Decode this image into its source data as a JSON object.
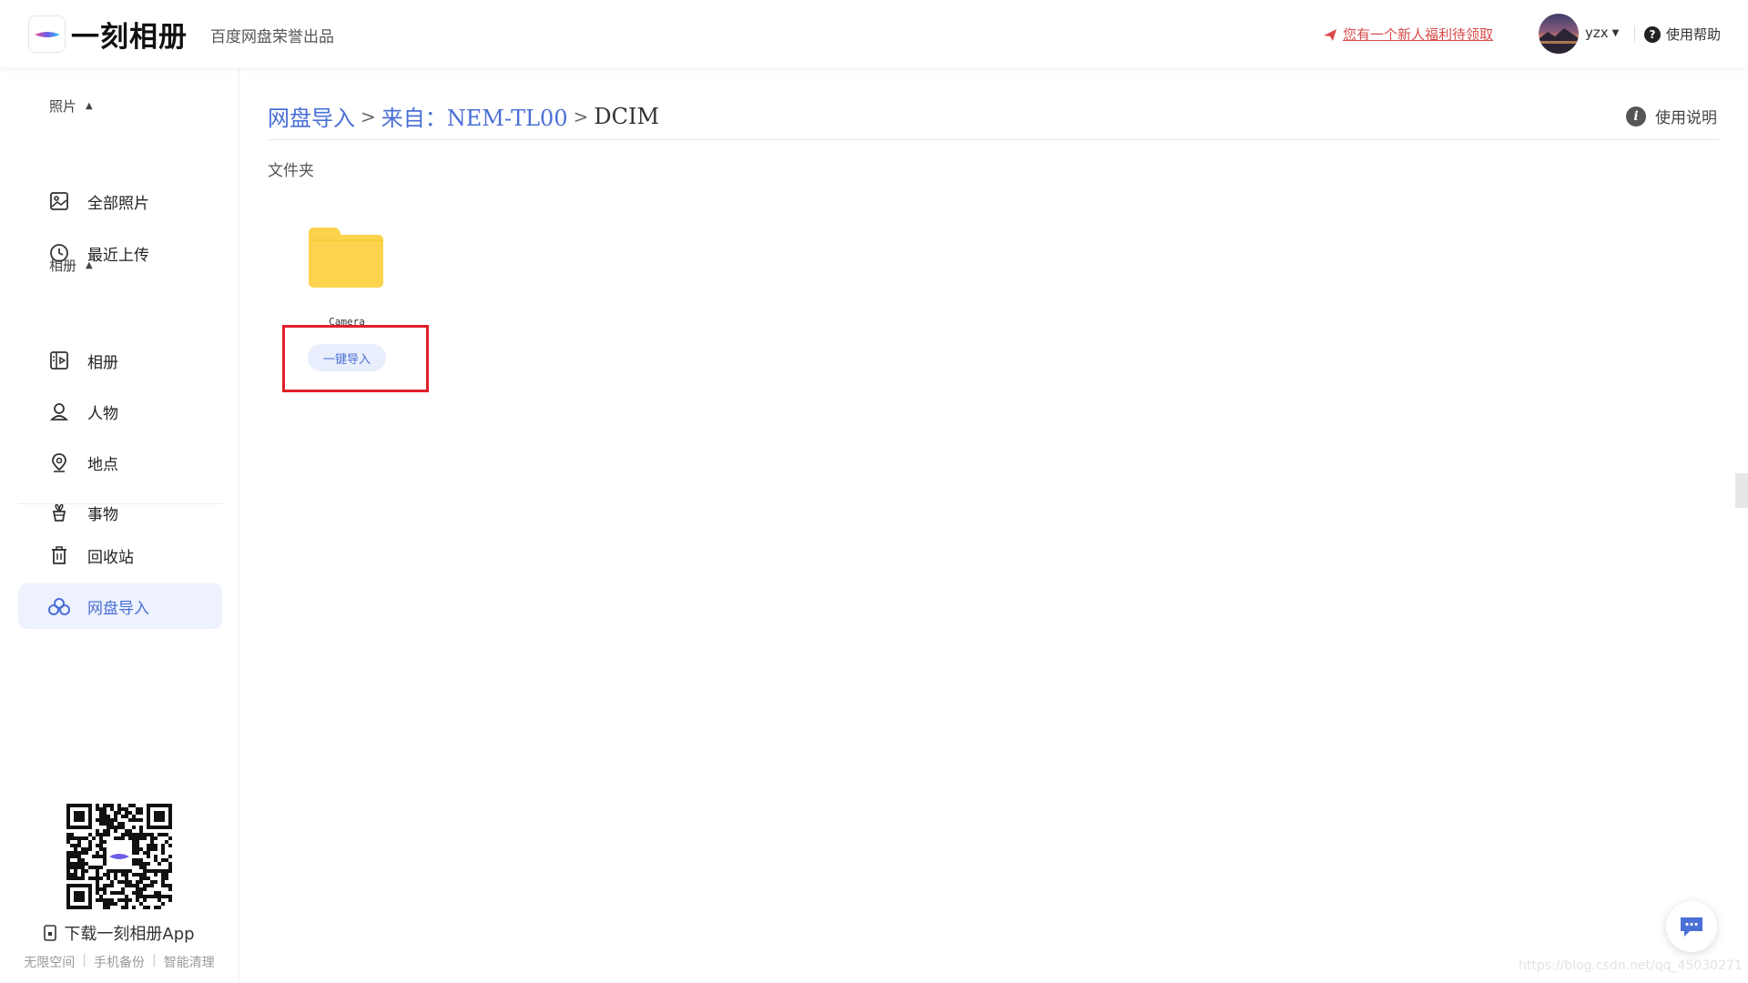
{
  "header": {
    "app_name": "一刻相册",
    "subtitle": "百度网盘荣誉出品",
    "promo_text": "您有一个新人福利待领取",
    "username": "yzx",
    "help_label": "使用帮助",
    "caret": "▼"
  },
  "sidebar": {
    "photos_section": "照片",
    "albums_section": "相册",
    "section_toggle": "▲",
    "items": [
      {
        "label": "全部照片",
        "icon": "image-icon"
      },
      {
        "label": "最近上传",
        "icon": "clock-icon"
      },
      {
        "label": "相册",
        "icon": "album-icon"
      },
      {
        "label": "人物",
        "icon": "person-icon"
      },
      {
        "label": "地点",
        "icon": "location-pin-icon"
      },
      {
        "label": "事物",
        "icon": "flower-icon"
      },
      {
        "label": "回收站",
        "icon": "trash-icon"
      },
      {
        "label": "网盘导入",
        "icon": "cloud-import-icon",
        "active": true
      }
    ],
    "download_caption": "下载一刻相册App",
    "footer_links": [
      "无限空间",
      "手机备份",
      "智能清理"
    ]
  },
  "main": {
    "breadcrumb": {
      "root": "网盘导入",
      "source": "来自：NEM-TL00",
      "current": "DCIM",
      "separator": ">"
    },
    "usage_label": "使用说明",
    "info_glyph": "i",
    "folder_section_label": "文件夹",
    "folders": [
      {
        "name": "Camera",
        "action_label": "一键导入"
      }
    ]
  },
  "watermark": "https://blog.csdn.net/qq_45030271",
  "colors": {
    "accent": "#4a6fd6",
    "active_bg": "#eef2fd",
    "promo": "#d94b4b",
    "folder": "#fcd34d",
    "highlight": "#e0202a"
  }
}
